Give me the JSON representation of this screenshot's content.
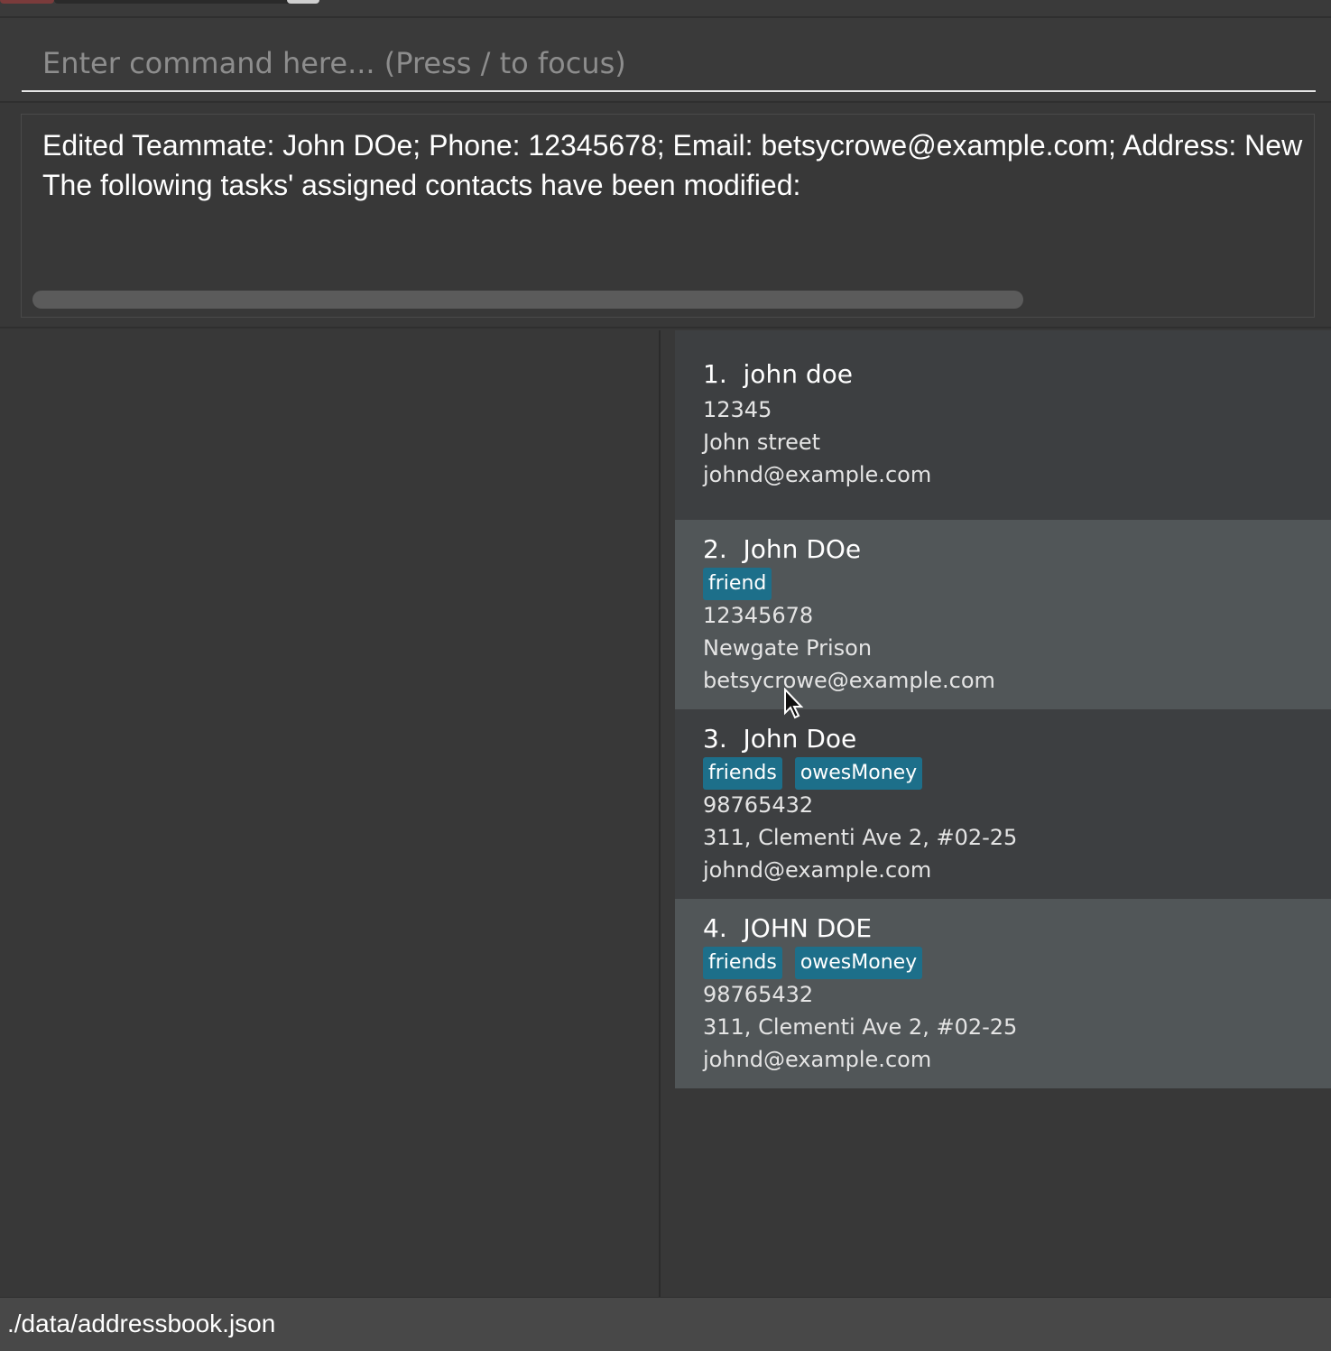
{
  "command_box": {
    "placeholder": "Enter command here... (Press / to focus)",
    "value": ""
  },
  "result_display": {
    "lines": [
      "Edited Teammate: John DOe; Phone: 12345678; Email: betsycrowe@example.com; Address: New",
      "The following tasks' assigned contacts have been modified:"
    ]
  },
  "contacts": [
    {
      "index": "1.",
      "name": "john doe",
      "tags": [],
      "phone": "12345",
      "address": "John street",
      "email": "johnd@example.com"
    },
    {
      "index": "2.",
      "name": "John DOe",
      "tags": [
        "friend"
      ],
      "phone": "12345678",
      "address": "Newgate Prison",
      "email": "betsycrowe@example.com"
    },
    {
      "index": "3.",
      "name": "John Doe",
      "tags": [
        "friends",
        "owesMoney"
      ],
      "phone": "98765432",
      "address": "311, Clementi Ave 2, #02-25",
      "email": "johnd@example.com"
    },
    {
      "index": "4.",
      "name": "JOHN DOE",
      "tags": [
        "friends",
        "owesMoney"
      ],
      "phone": "98765432",
      "address": "311, Clementi Ave 2, #02-25",
      "email": "johnd@example.com"
    }
  ],
  "status_bar": {
    "path": "./data/addressbook.json"
  },
  "colors": {
    "background": "#383838",
    "card_odd": "#3d3f41",
    "card_even": "#515658",
    "tag": "#1d6f8a"
  }
}
